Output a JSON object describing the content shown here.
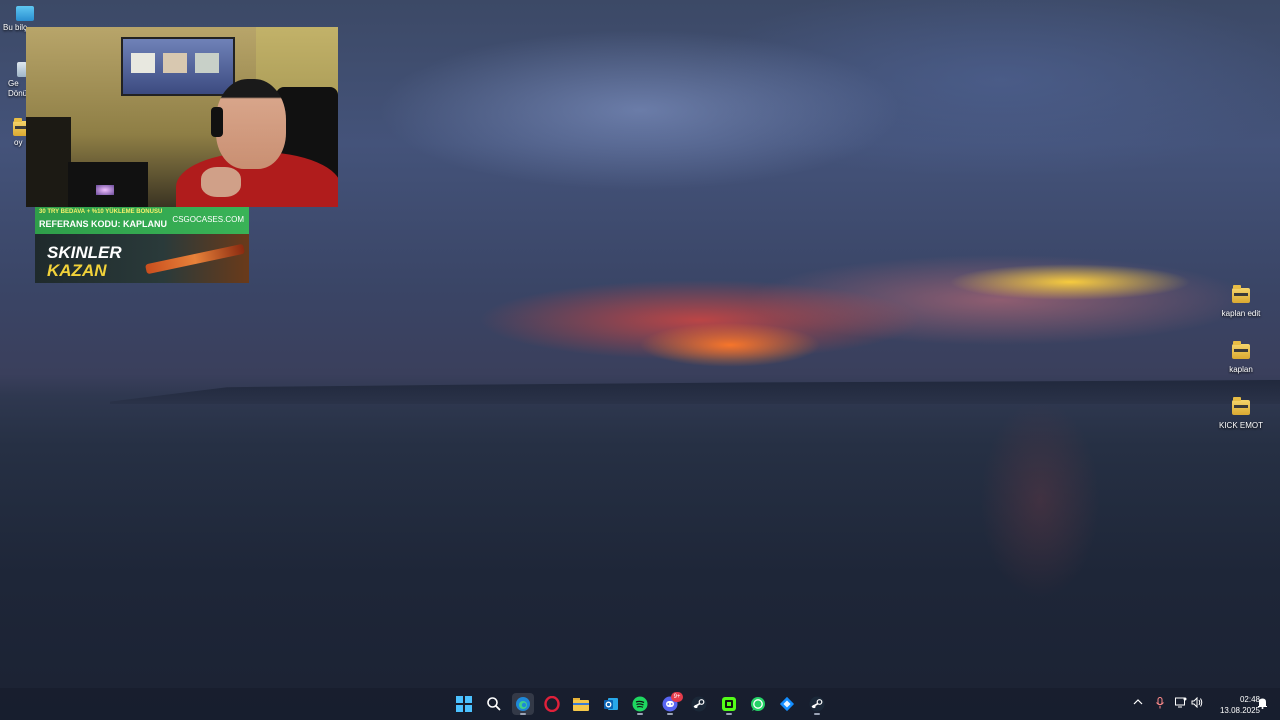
{
  "desktop": {
    "icons_left": [
      {
        "name": "this-pc",
        "label": "Bu bilç"
      },
      {
        "name": "recycle-bin",
        "label": "Ge\nDönü"
      },
      {
        "name": "folder-oyun",
        "label": "oy"
      }
    ],
    "icons_right": [
      {
        "name": "folder-kaplan-edit",
        "label": "kaplan edit"
      },
      {
        "name": "folder-kaplan",
        "label": "kaplan"
      },
      {
        "name": "folder-kick-emot",
        "label": "KICK EMOT"
      }
    ]
  },
  "ad": {
    "line1": "30 TRY BEDAVA + %10 YÜKLEME BONUSU",
    "line2": "REFERANS KODU: KAPLANU",
    "brand": "CSGOCASES.COM",
    "title1": "SKINLER",
    "title2": "KAZAN"
  },
  "taskbar": {
    "apps": [
      {
        "name": "start",
        "icon": "windows-logo"
      },
      {
        "name": "search",
        "icon": "search-icon"
      },
      {
        "name": "edge",
        "icon": "edge-icon"
      },
      {
        "name": "opera",
        "icon": "opera-icon"
      },
      {
        "name": "file-explorer",
        "icon": "folder-icon"
      },
      {
        "name": "outlook",
        "icon": "outlook-icon"
      },
      {
        "name": "spotify",
        "icon": "spotify-icon"
      },
      {
        "name": "discord",
        "icon": "discord-icon",
        "badge": "9+"
      },
      {
        "name": "steam",
        "icon": "steam-icon"
      },
      {
        "name": "kick",
        "icon": "kick-icon"
      },
      {
        "name": "whatsapp",
        "icon": "whatsapp-icon"
      },
      {
        "name": "battlenet",
        "icon": "battlenet-icon"
      },
      {
        "name": "steam-2",
        "icon": "steam-icon"
      }
    ],
    "tray": {
      "time": "02:48",
      "date": "13.08.2025"
    }
  },
  "colors": {
    "accent": "#4cc2ff",
    "ad_green": "#39b357",
    "ad_yellow": "#f2d23a"
  }
}
